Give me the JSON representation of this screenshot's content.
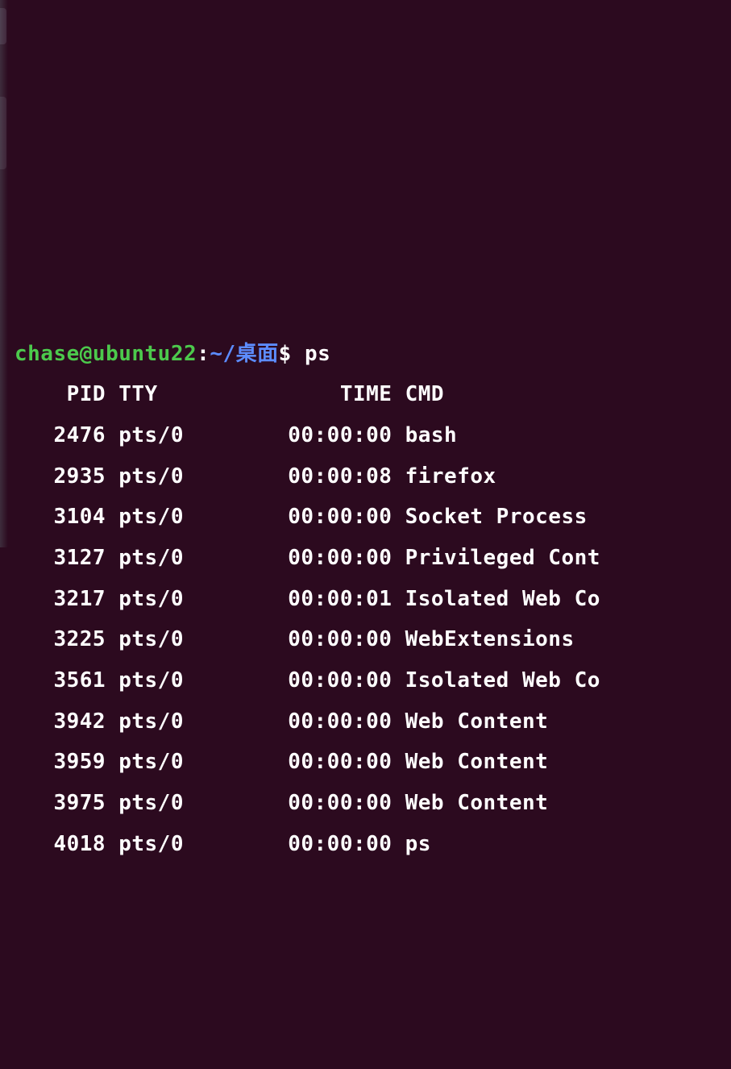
{
  "prompt": {
    "user_host": "chase@ubuntu22",
    "colon": ":",
    "path": "~/桌面",
    "symbol": "$",
    "command": "ps"
  },
  "headers": {
    "pid": "PID",
    "tty": "TTY",
    "time": "TIME",
    "cmd": "CMD"
  },
  "rows": [
    {
      "pid": "2476",
      "tty": "pts/0",
      "time": "00:00:00",
      "cmd": "bash"
    },
    {
      "pid": "2935",
      "tty": "pts/0",
      "time": "00:00:08",
      "cmd": "firefox"
    },
    {
      "pid": "3104",
      "tty": "pts/0",
      "time": "00:00:00",
      "cmd": "Socket Process"
    },
    {
      "pid": "3127",
      "tty": "pts/0",
      "time": "00:00:00",
      "cmd": "Privileged Cont"
    },
    {
      "pid": "3217",
      "tty": "pts/0",
      "time": "00:00:01",
      "cmd": "Isolated Web Co"
    },
    {
      "pid": "3225",
      "tty": "pts/0",
      "time": "00:00:00",
      "cmd": "WebExtensions"
    },
    {
      "pid": "3561",
      "tty": "pts/0",
      "time": "00:00:00",
      "cmd": "Isolated Web Co"
    },
    {
      "pid": "3942",
      "tty": "pts/0",
      "time": "00:00:00",
      "cmd": "Web Content"
    },
    {
      "pid": "3959",
      "tty": "pts/0",
      "time": "00:00:00",
      "cmd": "Web Content"
    },
    {
      "pid": "3975",
      "tty": "pts/0",
      "time": "00:00:00",
      "cmd": "Web Content"
    },
    {
      "pid": "4018",
      "tty": "pts/0",
      "time": "00:00:00",
      "cmd": "ps"
    }
  ],
  "col_widths": {
    "pid": 7,
    "tty": 8,
    "time": 13,
    "cmd": 20
  }
}
